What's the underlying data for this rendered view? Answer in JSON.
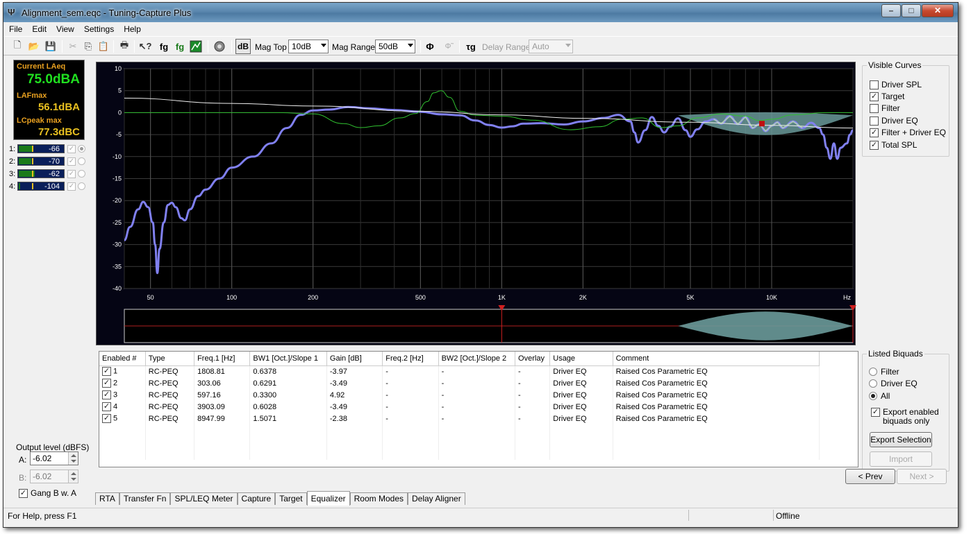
{
  "window": {
    "title": "Alignment_sem.eqc - Tuning-Capture Plus",
    "min": "–",
    "max": "□",
    "close": "✕"
  },
  "menu": [
    "File",
    "Edit",
    "View",
    "Settings",
    "Help"
  ],
  "toolbar": {
    "db_label": "dB",
    "mag_top_label": "Mag Top",
    "mag_top_value": "10dB",
    "mag_range_label": "Mag Range",
    "mag_range_value": "50dB",
    "delay_range_label": "Delay Range",
    "delay_range_value": "Auto",
    "fg1": "fg",
    "fg2": "fg",
    "tg": "τg",
    "phi": "Φ"
  },
  "meter_panel": {
    "laeq_label": "Current LAeq",
    "laeq_value": "75.0dBA",
    "lafmax_label": "LAFmax",
    "lafmax_value": "56.1dBA",
    "lcpeak_label": "LCpeak max",
    "lcpeak_value": "77.3dBC"
  },
  "channels": [
    {
      "num": "1:",
      "value": "-66",
      "level": 0.32,
      "radio": true
    },
    {
      "num": "2:",
      "value": "-70",
      "level": 0.28,
      "radio": false
    },
    {
      "num": "3:",
      "value": "-62",
      "level": 0.36,
      "radio": false
    },
    {
      "num": "4:",
      "value": "-104",
      "level": 0.02,
      "radio": false
    }
  ],
  "output": {
    "label": "Output level (dBFS)",
    "a_label": "A:",
    "a_value": "-6.02",
    "b_label": "B:",
    "b_value": "-6.02",
    "gang_label": "Gang B w. A"
  },
  "chart_data": {
    "type": "line",
    "xscale": "log",
    "xlim": [
      40,
      20000
    ],
    "ylim": [
      -40,
      10
    ],
    "yticks": [
      "10",
      "5",
      "0",
      "-5",
      "-10",
      "-15",
      "-20",
      "-25",
      "-30",
      "-35",
      "-40"
    ],
    "xticks": [
      [
        "50",
        50
      ],
      [
        "100",
        100
      ],
      [
        "200",
        200
      ],
      [
        "500",
        500
      ],
      [
        "1K",
        1000
      ],
      [
        "2K",
        2000
      ],
      [
        "5K",
        5000
      ],
      [
        "10K",
        10000
      ]
    ],
    "xunit": "Hz",
    "series": [
      {
        "color": "#8080f0",
        "points": [
          [
            40,
            -29
          ],
          [
            42,
            -26
          ],
          [
            45,
            -22
          ],
          [
            47,
            -20.3
          ],
          [
            49,
            -21.5
          ],
          [
            51,
            -25
          ],
          [
            52,
            -30
          ],
          [
            53,
            -36.5
          ],
          [
            54,
            -31
          ],
          [
            56,
            -25
          ],
          [
            58,
            -21
          ],
          [
            60,
            -20.5
          ],
          [
            62,
            -21.5
          ],
          [
            65,
            -24
          ],
          [
            67,
            -24.5
          ],
          [
            70,
            -22
          ],
          [
            75,
            -19
          ],
          [
            80,
            -17.5
          ],
          [
            90,
            -15
          ],
          [
            100,
            -12.5
          ],
          [
            120,
            -10
          ],
          [
            140,
            -7
          ],
          [
            160,
            -3.5
          ],
          [
            180,
            -0.5
          ],
          [
            200,
            0.5
          ],
          [
            230,
            0.7
          ],
          [
            270,
            1.3
          ],
          [
            320,
            1.0
          ],
          [
            400,
            0.6
          ],
          [
            500,
            0.2
          ],
          [
            600,
            -0.4
          ],
          [
            700,
            -0.6
          ],
          [
            800,
            -1.8
          ],
          [
            900,
            -2.8
          ],
          [
            1000,
            -3.4
          ],
          [
            1100,
            -3.1
          ],
          [
            1200,
            -2.5
          ],
          [
            1400,
            -2.4
          ],
          [
            1700,
            -2.7
          ],
          [
            2000,
            -2.0
          ],
          [
            2400,
            -1.2
          ],
          [
            2700,
            -0.5
          ],
          [
            3000,
            -2.0
          ],
          [
            3100,
            -4.5
          ],
          [
            3200,
            -6.8
          ],
          [
            3400,
            -4
          ],
          [
            3600,
            -1
          ],
          [
            3800,
            -3
          ],
          [
            4000,
            -4.5
          ],
          [
            4200,
            -3.2
          ],
          [
            4500,
            -1.3
          ],
          [
            4800,
            -4
          ],
          [
            5000,
            -5.5
          ],
          [
            5300,
            -3.8
          ],
          [
            5700,
            -2.0
          ],
          [
            6100,
            -1.5
          ],
          [
            6500,
            -2.5
          ],
          [
            7000,
            -0.8
          ],
          [
            7500,
            -2.6
          ],
          [
            8000,
            -1.0
          ],
          [
            8500,
            -3.5
          ],
          [
            9000,
            -2.6
          ],
          [
            9500,
            -4.2
          ],
          [
            10000,
            -3
          ],
          [
            10500,
            -2.2
          ],
          [
            11000,
            -3.5
          ],
          [
            12000,
            -2
          ],
          [
            13000,
            -3.5
          ],
          [
            14000,
            -2.3
          ],
          [
            15000,
            -3.5
          ],
          [
            15500,
            -5
          ],
          [
            16000,
            -8
          ],
          [
            16500,
            -10.5
          ],
          [
            17000,
            -7
          ],
          [
            17500,
            -10.5
          ],
          [
            18000,
            -8
          ],
          [
            19000,
            -7
          ],
          [
            19500,
            -5
          ],
          [
            20000,
            -4
          ]
        ]
      },
      {
        "color": "#30c030",
        "points": [
          [
            40,
            0
          ],
          [
            150,
            0
          ],
          [
            200,
            -0.3
          ],
          [
            260,
            -2.5
          ],
          [
            300,
            -3.4
          ],
          [
            350,
            -3
          ],
          [
            420,
            -1.2
          ],
          [
            480,
            -0.2
          ],
          [
            530,
            2.5
          ],
          [
            560,
            4.5
          ],
          [
            597,
            5
          ],
          [
            640,
            3.5
          ],
          [
            700,
            0.3
          ],
          [
            800,
            -0.6
          ],
          [
            1000,
            -0.8
          ],
          [
            1300,
            -1.7
          ],
          [
            1800,
            -3.9
          ],
          [
            2300,
            -3.2
          ],
          [
            2800,
            -1.5
          ],
          [
            3300,
            -1.2
          ],
          [
            3900,
            -3.4
          ],
          [
            4500,
            -3
          ],
          [
            5300,
            -1.2
          ],
          [
            6500,
            -0.3
          ],
          [
            8000,
            -0.8
          ],
          [
            9000,
            -1.8
          ],
          [
            10000,
            -1.5
          ],
          [
            12000,
            -0.5
          ],
          [
            16000,
            0
          ],
          [
            20000,
            0
          ]
        ]
      },
      {
        "color": "#f0f0f0",
        "points": [
          [
            40,
            3.3
          ],
          [
            100,
            2.1
          ],
          [
            200,
            1.5
          ],
          [
            500,
            0.3
          ],
          [
            1000,
            -0.5
          ],
          [
            2000,
            -1.3
          ],
          [
            5000,
            -2.2
          ],
          [
            10000,
            -2.9
          ],
          [
            20000,
            -3.5
          ]
        ]
      }
    ],
    "target_band": {
      "color": "#6a9a9a",
      "f_start": 4500,
      "f_end": 20000,
      "center": -0.6,
      "depth": 4.5
    },
    "marker": {
      "color": "#c01010",
      "freq": 9200,
      "db": -2.5
    },
    "overview_markers": [
      1000,
      20000
    ]
  },
  "visible_curves": {
    "title": "Visible Curves",
    "items": [
      {
        "label": "Driver SPL",
        "checked": false
      },
      {
        "label": "Target",
        "checked": true
      },
      {
        "label": "Filter",
        "checked": false
      },
      {
        "label": "Driver EQ",
        "checked": false
      },
      {
        "label": "Filter + Driver EQ",
        "checked": true
      },
      {
        "label": "Total SPL",
        "checked": true
      }
    ]
  },
  "eq_table": {
    "headers": [
      "Enabled #",
      "Type",
      "Freq.1 [Hz]",
      "BW1 [Oct.]/Slope 1",
      "Gain [dB]",
      "Freq.2 [Hz]",
      "BW2 [Oct.]/Slope 2",
      "Overlay",
      "Usage",
      "Comment"
    ],
    "rows": [
      [
        "1",
        "RC-PEQ",
        "1808.81",
        "0.6378",
        "-3.97",
        "-",
        "-",
        "-",
        "Driver EQ",
        "Raised Cos Parametric EQ"
      ],
      [
        "2",
        "RC-PEQ",
        "303.06",
        "0.6291",
        "-3.49",
        "-",
        "-",
        "-",
        "Driver EQ",
        "Raised Cos Parametric EQ"
      ],
      [
        "3",
        "RC-PEQ",
        "597.16",
        "0.3300",
        "4.92",
        "-",
        "-",
        "-",
        "Driver EQ",
        "Raised Cos Parametric EQ"
      ],
      [
        "4",
        "RC-PEQ",
        "3903.09",
        "0.6028",
        "-3.49",
        "-",
        "-",
        "-",
        "Driver EQ",
        "Raised Cos Parametric EQ"
      ],
      [
        "5",
        "RC-PEQ",
        "8947.99",
        "1.5071",
        "-2.38",
        "-",
        "-",
        "-",
        "Driver EQ",
        "Raised Cos Parametric EQ"
      ]
    ]
  },
  "listed_biquads": {
    "title": "Listed Biquads",
    "options": [
      {
        "label": "Filter",
        "selected": false
      },
      {
        "label": "Driver EQ",
        "selected": false
      },
      {
        "label": "All",
        "selected": true
      }
    ],
    "export_enabled_label": "Export enabled biquads only",
    "export_button": "Export Selection",
    "import_button": "Import"
  },
  "nav": {
    "prev": "< Prev",
    "next": "Next >"
  },
  "tabs": [
    {
      "label": "RTA",
      "active": false
    },
    {
      "label": "Transfer Fn",
      "active": false
    },
    {
      "label": "SPL/LEQ Meter",
      "active": false
    },
    {
      "label": "Capture",
      "active": false
    },
    {
      "label": "Target",
      "active": false
    },
    {
      "label": "Equalizer",
      "active": true
    },
    {
      "label": "Room Modes",
      "active": false
    },
    {
      "label": "Delay Aligner",
      "active": false
    }
  ],
  "status": {
    "help": "For Help, press F1",
    "state": "Offline"
  }
}
